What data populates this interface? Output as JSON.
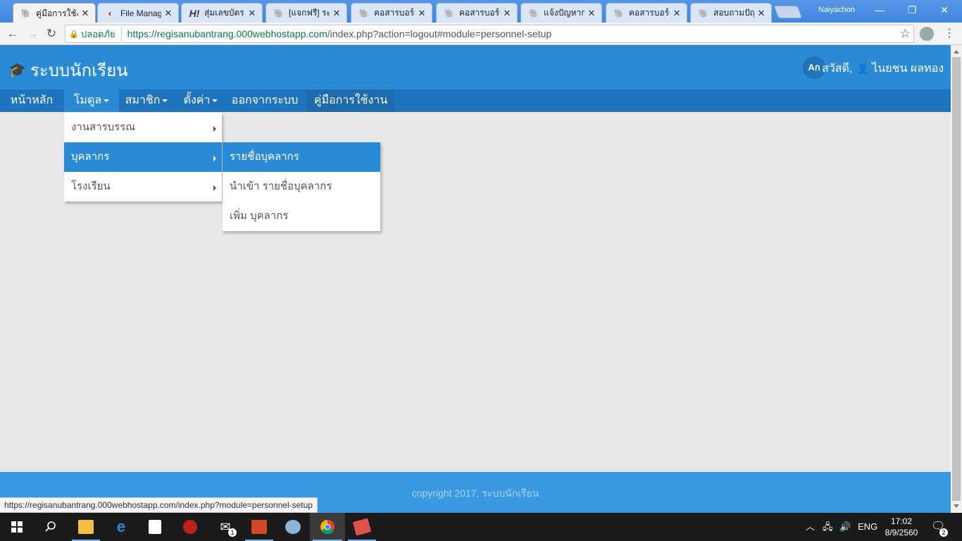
{
  "browser": {
    "tabs": [
      {
        "title": "คู่มือการใช้งาน",
        "icon": "elephant-icon",
        "active": true
      },
      {
        "title": "File Manager",
        "icon": "pdf-icon"
      },
      {
        "title": "สุ่มเลขบัตร ป",
        "icon": "h-icon"
      },
      {
        "title": "[แจกฟรี] ระบบ",
        "icon": "elephant-icon"
      },
      {
        "title": "คอสารบอร์ด",
        "icon": "elephant-icon"
      },
      {
        "title": "คอสารบอร์ด",
        "icon": "elephant-icon"
      },
      {
        "title": "แจ้งปัญหาการ",
        "icon": "elephant-icon"
      },
      {
        "title": "คอสารบอร์ด",
        "icon": "elephant-icon"
      },
      {
        "title": "สอบถามปัญหา",
        "icon": "elephant-icon"
      }
    ],
    "profile_name": "Naiyachon",
    "secure_label": "ปลอดภัย",
    "url_host": "https://regisanubantrang.000webhostapp.com",
    "url_path": "/index.php?action=logout#module=personnel-setup",
    "status_url": "https://regisanubantrang.000webhostapp.com/index.php?module=personnel-setup"
  },
  "app": {
    "brand": "ระบบนักเรียน",
    "translate_label": "Aก",
    "greeting": "สวัสดี,",
    "user_name": "ไนยชน ผลทอง",
    "nav": [
      {
        "label": "หน้าหลัก"
      },
      {
        "label": "โมดูล",
        "caret": true
      },
      {
        "label": "สมาชิก",
        "caret": true
      },
      {
        "label": "ตั้งค่า",
        "caret": true
      },
      {
        "label": "ออกจากระบบ"
      },
      {
        "label": "คู่มือการใช้งาน"
      }
    ],
    "module_menu": [
      {
        "label": "งานสารบรรณ"
      },
      {
        "label": "บุคลากร"
      },
      {
        "label": "โรงเรียน"
      }
    ],
    "personnel_submenu": [
      {
        "label": "รายชื่อบุคลากร"
      },
      {
        "label": "นำเข้า รายชื่อบุคลากร"
      },
      {
        "label": "เพิ่ม บุคลากร"
      }
    ],
    "footer": "copyright 2017, ระบบนักเรียน"
  },
  "taskbar": {
    "language": "ENG",
    "time": "17:02",
    "date": "8/9/2560",
    "mail_badge": "1",
    "notification_badge": "2"
  }
}
